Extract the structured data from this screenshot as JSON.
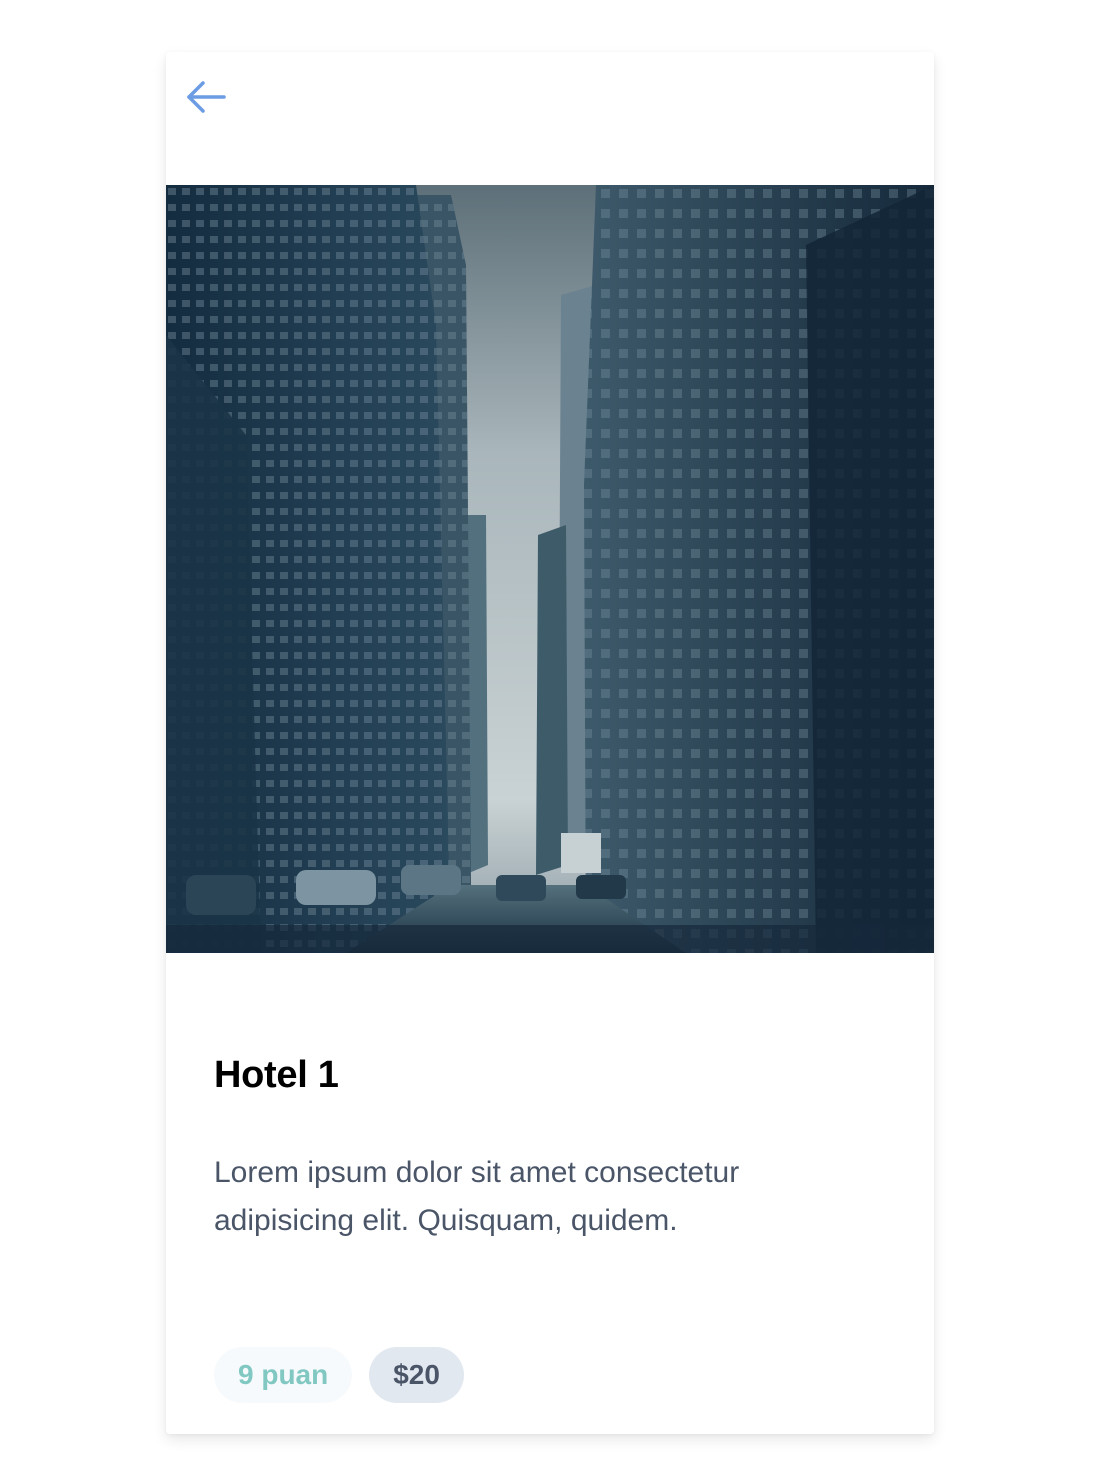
{
  "header": {
    "back_icon": "arrow-left-icon",
    "accent_color": "#6b9ce4"
  },
  "hotel": {
    "image_alt": "",
    "title": "Hotel 1",
    "description": "Lorem ipsum dolor sit amet consectetur adipisicing elit. Quisquam, quidem.",
    "rating_label": "9 puan",
    "price_label": "$20"
  },
  "colors": {
    "rating_text": "#81c8c2",
    "rating_bg": "#f7fafc",
    "price_text": "#4a5568",
    "price_bg": "#e2e8f0",
    "description_text": "#4a5568"
  }
}
